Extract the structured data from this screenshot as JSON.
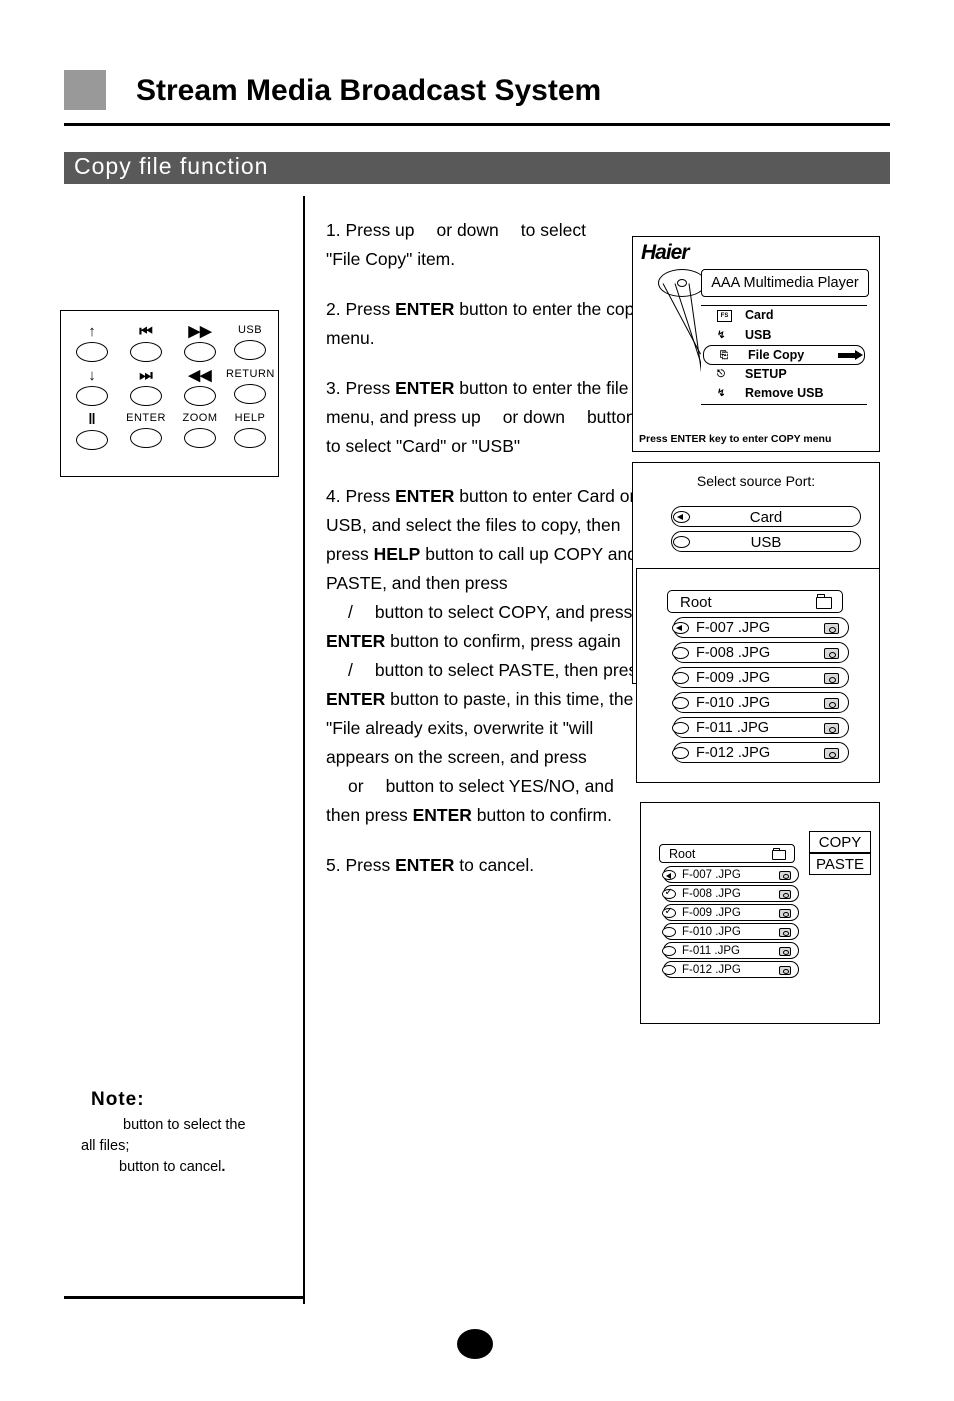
{
  "header": {
    "title": "Stream Media Broadcast System",
    "section": "Copy file function"
  },
  "remote": {
    "keys": [
      {
        "glyph": "↑",
        "label": ""
      },
      {
        "glyph": "⏮",
        "label": ""
      },
      {
        "glyph": "▶▶",
        "label": ""
      },
      {
        "glyph": "",
        "label": "USB"
      },
      {
        "glyph": "↓",
        "label": ""
      },
      {
        "glyph": "⏭",
        "label": ""
      },
      {
        "glyph": "◀◀",
        "label": ""
      },
      {
        "glyph": "",
        "label": "RETURN"
      },
      {
        "glyph": "‖",
        "label": ""
      },
      {
        "glyph": "",
        "label": "ENTER"
      },
      {
        "glyph": "",
        "label": "ZOOM"
      },
      {
        "glyph": "",
        "label": "HELP"
      }
    ]
  },
  "steps": {
    "s1a": "1. Press up",
    "s1b": "or down",
    "s1c": "to select",
    "s1d": "\"File Copy\" item.",
    "s2a": "2. Press ",
    "s2b": "ENTER",
    "s2c": " button to enter the copy menu.",
    "s3a": "3. Press ",
    "s3b": "ENTER",
    "s3c": " button to enter the file menu, and press up",
    "s3d": "or down",
    "s3e": "button to select \"Card\" or \"USB\"",
    "s4a": "4. Press ",
    "s4b": "ENTER",
    "s4c": " button to enter Card or USB, and select the files to copy, then press ",
    "s4d": "HELP",
    "s4e": " button to call up COPY and PASTE,  and then press",
    "s4f": "/",
    "s4g": "button  to select COPY, and press ",
    "s4h": "ENTER",
    "s4i": " button to confirm, press again",
    "s4j": "/",
    "s4k": "button to select PASTE, then press",
    "s4l": "ENTER",
    "s4m": " button to paste, in this time, the \"File already exits, overwrite it   \"will appears on the screen, and press",
    "s4n": "or",
    "s4o": "button to select YES/NO, and then press ",
    "s4p": "ENTER",
    "s4q": " button to confirm.",
    "s5a": "5. Press ",
    "s5b": "ENTER",
    "s5c": " to cancel."
  },
  "note": {
    "title": "Note:",
    "line1": "button to select the",
    "line2": "all files;",
    "line3": "button to cancel",
    "line3end": "."
  },
  "osd_menu": {
    "logo": "Haier",
    "device_title": "AAA Multimedia Player",
    "items": [
      {
        "label": "Card",
        "icon": "card-icon",
        "selected": false
      },
      {
        "label": "USB",
        "icon": "usb-icon",
        "selected": false
      },
      {
        "label": "File Copy",
        "icon": "copy-icon",
        "selected": true
      },
      {
        "label": "SETUP",
        "icon": "setup-icon",
        "selected": false
      },
      {
        "label": "Remove USB",
        "icon": "eject-icon",
        "selected": false
      }
    ],
    "footer": "Press ENTER key to enter COPY menu"
  },
  "osd_source": {
    "title": "Select source Port:",
    "options": [
      {
        "label": "Card",
        "selected": true
      },
      {
        "label": "USB",
        "selected": false
      }
    ]
  },
  "osd_files": {
    "root_label": "Root",
    "files": [
      {
        "name": "F-007 .JPG",
        "selected": true
      },
      {
        "name": "F-008 .JPG",
        "selected": false
      },
      {
        "name": "F-009 .JPG",
        "selected": false
      },
      {
        "name": "F-010 .JPG",
        "selected": false
      },
      {
        "name": "F-011 .JPG",
        "selected": false
      },
      {
        "name": "F-012 .JPG",
        "selected": false
      }
    ]
  },
  "osd_copy": {
    "root_label": "Root",
    "files": [
      {
        "name": "F-007 .JPG",
        "state": "selected"
      },
      {
        "name": "F-008 .JPG",
        "state": "checked"
      },
      {
        "name": "F-009 .JPG",
        "state": "checked"
      },
      {
        "name": "F-010 .JPG",
        "state": "empty"
      },
      {
        "name": "F-011 .JPG",
        "state": "empty"
      },
      {
        "name": "F-012 .JPG",
        "state": "empty"
      }
    ],
    "copy_label": "COPY",
    "paste_label": "PASTE"
  }
}
